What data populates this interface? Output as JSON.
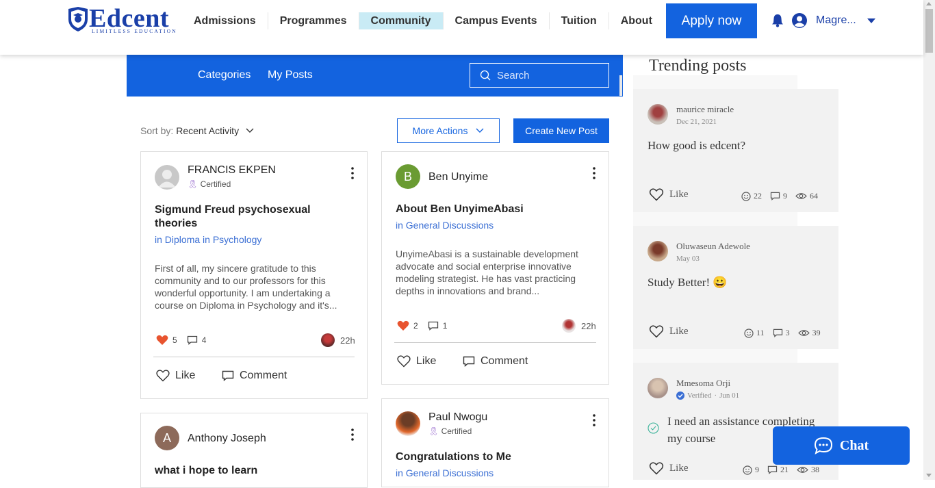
{
  "brand": {
    "name": "Edcent",
    "tagline": "LIMITLESS EDUCATION",
    "color": "#1a3fa8"
  },
  "nav": {
    "items": [
      {
        "label": "Admissions"
      },
      {
        "label": "Programmes"
      },
      {
        "label": "Community",
        "active": true
      },
      {
        "label": "Campus Events"
      },
      {
        "label": "Tuition"
      },
      {
        "label": "About"
      }
    ],
    "apply_label": "Apply now",
    "user_name": "Magre..."
  },
  "forum": {
    "categories_label": "Categories",
    "my_posts_label": "My Posts",
    "search_placeholder": "Search",
    "sort_label": "Sort by:",
    "sort_value": "Recent Activity",
    "more_actions_label": "More Actions",
    "create_post_label": "Create New Post",
    "like_label": "Like",
    "comment_label": "Comment"
  },
  "posts": [
    {
      "author": "FRANCIS EKPEN",
      "badge": "Certified",
      "title_line1": "Sigmund Freud psychosexual",
      "title_line2": "theories",
      "category": "in Diploma in Psychology",
      "body": "First of all, my sincere gratitude to this community and to our professors for this wonderful opportunity. I am undertaking a course on Diploma in Psychology and it's...",
      "likes": "5",
      "comments": "4",
      "time": "22h"
    },
    {
      "author": "Ben Unyime",
      "avatar_letter": "B",
      "title_line1": "About Ben UnyimeAbasi",
      "category": "in General Discussions",
      "body": "UnyimeAbasi is a sustainable development advocate and social enterprise innovative modeling strategist. He has vast practicing depths in innovations and brand...",
      "likes": "2",
      "comments": "1",
      "time": "22h"
    },
    {
      "author": "Anthony Joseph",
      "avatar_letter": "A",
      "title_line1": "what i hope to learn"
    },
    {
      "author": "Paul Nwogu",
      "badge": "Certified",
      "title_line1": "Congratulations to Me",
      "category": "in General Discussions"
    }
  ],
  "trending": {
    "title": "Trending posts",
    "like_label": "Like",
    "items": [
      {
        "name": "maurice miracle",
        "date": "Dec 21, 2021",
        "title": "How good is edcent?",
        "reactions": "22",
        "comments": "9",
        "views": "64"
      },
      {
        "name": "Oluwaseun Adewole",
        "date": "May 03",
        "title": "Study Better! 😀",
        "reactions": "11",
        "comments": "3",
        "views": "39"
      },
      {
        "name": "Mmesoma Orji",
        "verified": "Verified",
        "date": "Jun 01",
        "title_line1": "I need an assistance completing",
        "title_line2": "my course",
        "reactions": "9",
        "comments": "21",
        "views": "38"
      }
    ]
  },
  "chat": {
    "label": "Chat"
  },
  "colors": {
    "accent": "#1363df",
    "heart": "#e8542f",
    "nav_active_bg": "#c9ebf5"
  }
}
